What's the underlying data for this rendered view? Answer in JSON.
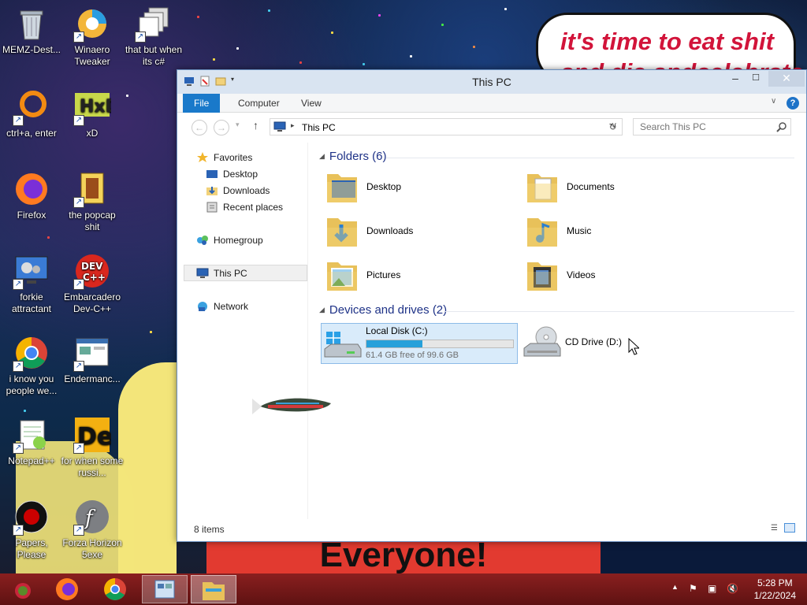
{
  "desktop": {
    "bubble_line1": "it's time to eat shit",
    "bubble_line2": "and die andcelebrate",
    "banner_text": "Everyone!",
    "icons": [
      {
        "label": "MEMZ-Dest...",
        "icon": "recycle-bin-icon"
      },
      {
        "label": "Winaero Tweaker",
        "icon": "winaero-tweaker-icon"
      },
      {
        "label": "that but when its c#",
        "icon": "windows-stack-icon"
      },
      {
        "label": "ctrl+a, enter",
        "icon": "orange-ring-icon"
      },
      {
        "label": "xD",
        "icon": "hxd-icon"
      },
      {
        "label": "Firefox",
        "icon": "firefox-icon"
      },
      {
        "label": "the popcap shit",
        "icon": "popcap-icon"
      },
      {
        "label": "forkie attractant",
        "icon": "monitor-gear-icon"
      },
      {
        "label": "Embarcadero Dev-C++",
        "icon": "devcpp-icon"
      },
      {
        "label": "i know you people we...",
        "icon": "chrome-icon"
      },
      {
        "label": "Endermanc...",
        "icon": "window-app-icon"
      },
      {
        "label": "Notepad++",
        "icon": "notepadpp-icon"
      },
      {
        "label": "for when some russi...",
        "icon": "de-icon"
      },
      {
        "label": "Papers, Please",
        "icon": "papers-please-icon"
      },
      {
        "label": "Forza Horizon 5exe",
        "icon": "flash-icon"
      }
    ]
  },
  "window": {
    "title": "This PC",
    "ribbon_tabs": [
      "File",
      "Computer",
      "View"
    ],
    "address": "This PC",
    "search_placeholder": "Search This PC",
    "nav": {
      "favorites": "Favorites",
      "desktop": "Desktop",
      "downloads": "Downloads",
      "recent": "Recent places",
      "homegroup": "Homegroup",
      "thispc": "This PC",
      "network": "Network"
    },
    "folders_header": "Folders (6)",
    "folders": [
      "Desktop",
      "Documents",
      "Downloads",
      "Music",
      "Pictures",
      "Videos"
    ],
    "devices_header": "Devices and drives (2)",
    "local_disk": {
      "name": "Local Disk (C:)",
      "free_text": "61.4 GB free of 99.6 GB",
      "used_fraction": 0.383
    },
    "cd_drive": "CD Drive (D:)",
    "status": "8 items"
  },
  "taskbar": {
    "time": "5:28 PM",
    "date": "1/22/2024"
  },
  "colors": {
    "accent": "#1979ca",
    "group_header": "#1e3287",
    "taskbar": "#7a1a1a"
  }
}
